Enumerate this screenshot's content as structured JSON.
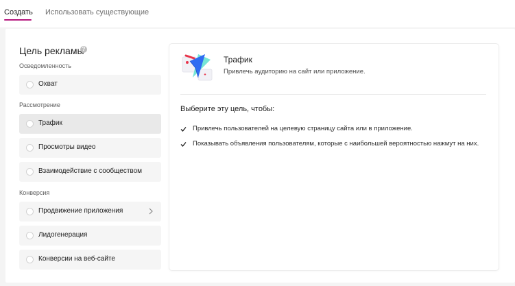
{
  "tabs": [
    {
      "label": "Создать",
      "active": true
    },
    {
      "label": "Использовать существующие",
      "active": false
    }
  ],
  "objective": {
    "title": "Цель рекламы",
    "sections": [
      {
        "label": "Осведомленность",
        "options": [
          {
            "label": "Охват"
          }
        ]
      },
      {
        "label": "Рассмотрение",
        "options": [
          {
            "label": "Трафик",
            "selected": true
          },
          {
            "label": "Просмотры видео"
          },
          {
            "label": "Взаимодействие с сообществом"
          }
        ]
      },
      {
        "label": "Конверсия",
        "options": [
          {
            "label": "Продвижение приложения",
            "has_submenu": true
          },
          {
            "label": "Лидогенерация"
          },
          {
            "label": "Конверсии на веб-сайте"
          }
        ]
      }
    ]
  },
  "detail": {
    "title": "Трафик",
    "description": "Привлечь аудиторию на сайт или приложение.",
    "goals_heading": "Выберите эту цель, чтобы:",
    "goals": [
      "Привлечь пользователей на целевую страницу сайта или в приложение.",
      "Показывать объявления пользователям, которые с наибольшей вероятностью нажмут на них."
    ]
  },
  "colors": {
    "accent": "#b5177e",
    "illustration_blue": "#2f6cf2",
    "illustration_red": "#e8334a",
    "illustration_teal": "#5ee0cf"
  }
}
